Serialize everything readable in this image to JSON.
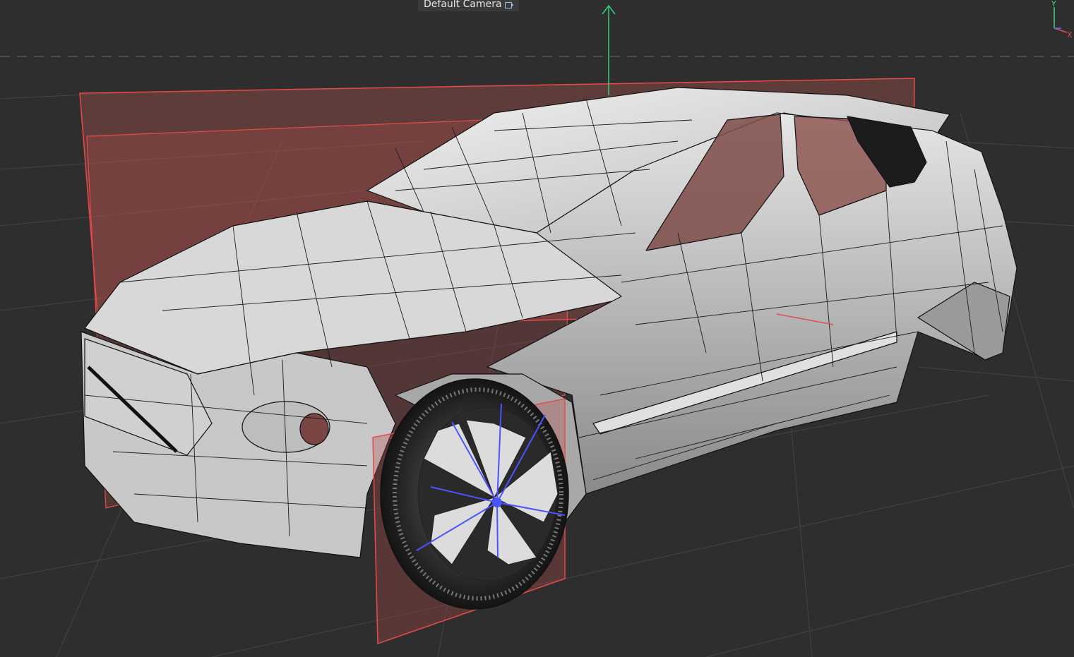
{
  "viewport": {
    "camera_name": "Default Camera",
    "camera_icon": "camera-icon",
    "background_color": "#2e2e2e",
    "grid_color": "#3f3f3f",
    "horizon_color": "#5a5a5a"
  },
  "axis_widget": {
    "y_label": "Y",
    "x_label": "X",
    "y_color": "#4cd17a",
    "x_color": "#e05050",
    "z_color": "#4a78ff"
  },
  "gizmo": {
    "y_axis_color": "#33d17a",
    "x_axis_color": "#e05050"
  },
  "object": {
    "type": "car-body-mesh",
    "body_color": "#bdbdbd",
    "wire_color": "#111111",
    "selection_plane_color": "#e84a4a",
    "wheel_selection_color": "#4a55ff"
  }
}
